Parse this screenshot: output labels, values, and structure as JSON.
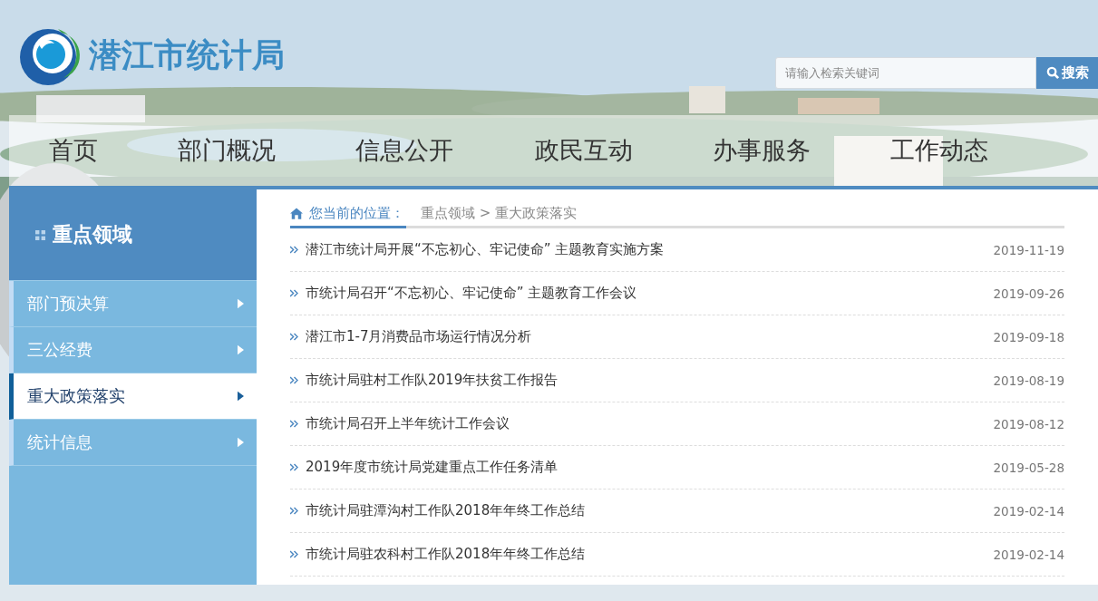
{
  "site": {
    "title": "潜江市统计局"
  },
  "search": {
    "placeholder": "请输入检索关键词",
    "button": "搜索"
  },
  "nav": [
    {
      "label": "首页"
    },
    {
      "label": "部门概况"
    },
    {
      "label": "信息公开"
    },
    {
      "label": "政民互动"
    },
    {
      "label": "办事服务"
    },
    {
      "label": "工作动态"
    }
  ],
  "sidebar": {
    "title": "重点领域",
    "items": [
      {
        "label": "部门预决算",
        "selected": false
      },
      {
        "label": "三公经费",
        "selected": false
      },
      {
        "label": "重大政策落实",
        "selected": true
      },
      {
        "label": "统计信息",
        "selected": false
      }
    ]
  },
  "breadcrumb": {
    "label": "您当前的位置：",
    "path": "重点领域 > 重大政策落实"
  },
  "articles": [
    {
      "title": "潜江市统计局开展“不忘初心、牢记使命” 主题教育实施方案",
      "date": "2019-11-19"
    },
    {
      "title": "市统计局召开“不忘初心、牢记使命” 主题教育工作会议",
      "date": "2019-09-26"
    },
    {
      "title": "潜江市1-7月消费品市场运行情况分析",
      "date": "2019-09-18"
    },
    {
      "title": "市统计局驻村工作队2019年扶贫工作报告",
      "date": "2019-08-19"
    },
    {
      "title": "市统计局召开上半年统计工作会议",
      "date": "2019-08-12"
    },
    {
      "title": "2019年度市统计局党建重点工作任务清单",
      "date": "2019-05-28"
    },
    {
      "title": "市统计局驻潭沟村工作队2018年年终工作总结",
      "date": "2019-02-14"
    },
    {
      "title": "市统计局驻农科村工作队2018年年终工作总结",
      "date": "2019-02-14"
    }
  ]
}
